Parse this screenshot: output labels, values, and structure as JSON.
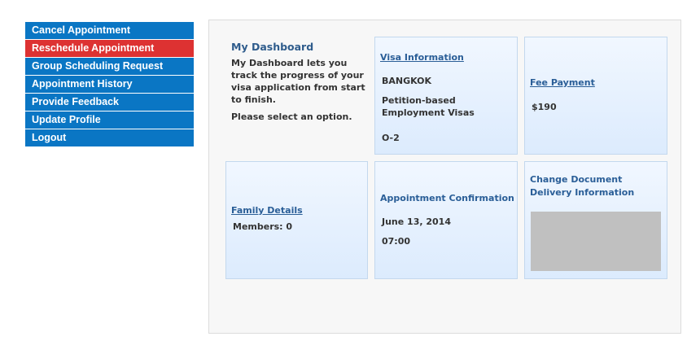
{
  "sidebar": {
    "items": [
      {
        "label": "Cancel Appointment"
      },
      {
        "label": "Reschedule Appointment"
      },
      {
        "label": "Group Scheduling Request"
      },
      {
        "label": "Appointment History"
      },
      {
        "label": "Provide Feedback"
      },
      {
        "label": "Update Profile"
      },
      {
        "label": "Logout"
      }
    ],
    "active_index": 1,
    "colors": {
      "item_bg": "#0a76c4",
      "active_bg": "#dd3232",
      "text": "#ffffff"
    }
  },
  "dashboard": {
    "title": "My Dashboard",
    "description": "My Dashboard lets you track the progress of your visa application from start to finish.",
    "prompt": "Please select an option."
  },
  "visa_info": {
    "link": "Visa Information",
    "location": "BANGKOK",
    "category": "Petition-based Employment Visas",
    "class": "O-2"
  },
  "fee_payment": {
    "link": "Fee Payment",
    "amount": "$190"
  },
  "family": {
    "link": "Family Details",
    "members": "Members: 0"
  },
  "appointment": {
    "heading": "Appointment Confirmation",
    "date": "June 13, 2014",
    "time": "07:00"
  },
  "delivery": {
    "heading": "Change Document Delivery Information"
  }
}
